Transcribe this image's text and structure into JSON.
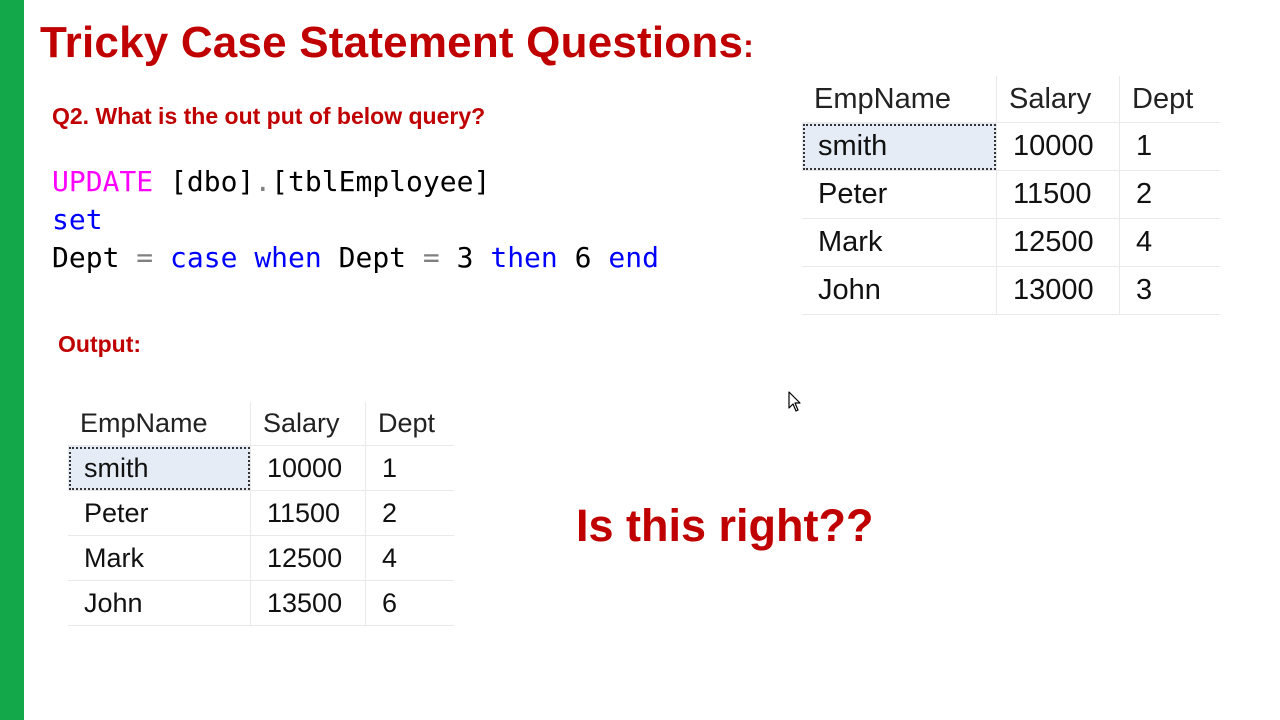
{
  "slide": {
    "title": "Tricky Case Statement Questions",
    "title_suffix": ":",
    "question": "Q2. What is the out put of below query?",
    "code": {
      "line1": {
        "kw": "UPDATE",
        "rest": " [dbo]",
        "dot": ".",
        "rest2": "[tblEmployee]"
      },
      "line2": {
        "kw": "set"
      },
      "line3": {
        "a": "Dept ",
        "eq1": "=",
        "b": " ",
        "case": "case",
        "c": " ",
        "when": "when",
        "d": " Dept ",
        "eq2": "=",
        "e": " 3 ",
        "then": "then",
        "f": " 6 ",
        "end": "end"
      }
    },
    "output_label": "Output:",
    "question_big": "Is this right??"
  },
  "input_table": {
    "headers": [
      "EmpName",
      "Salary",
      "Dept"
    ],
    "rows": [
      [
        "smith",
        "10000",
        "1"
      ],
      [
        "Peter",
        "11500",
        "2"
      ],
      [
        "Mark",
        "12500",
        "4"
      ],
      [
        "John",
        "13000",
        "3"
      ]
    ]
  },
  "output_table": {
    "headers": [
      "EmpName",
      "Salary",
      "Dept"
    ],
    "rows": [
      [
        "smith",
        "10000",
        "1"
      ],
      [
        "Peter",
        "11500",
        "2"
      ],
      [
        "Mark",
        "12500",
        "4"
      ],
      [
        "John",
        "13500",
        "6"
      ]
    ]
  },
  "colors": {
    "accent_bar": "#13a84a",
    "heading_red": "#c00000",
    "keyword_magenta": "#ff00ff",
    "keyword_blue": "#0000ff",
    "selected_cell": "#e6ecf5"
  },
  "icons": [
    "mouse-cursor-icon"
  ]
}
